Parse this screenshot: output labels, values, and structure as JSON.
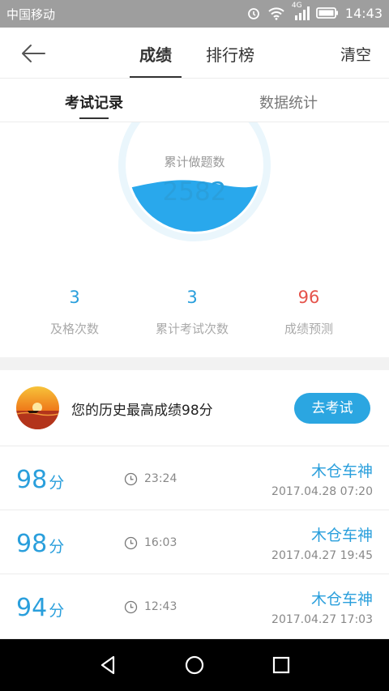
{
  "status_bar": {
    "carrier": "中国移动",
    "time": "14:43",
    "network": "4G"
  },
  "header": {
    "back_icon": "back-arrow-icon",
    "tabs": [
      {
        "label": "成绩",
        "active": true
      },
      {
        "label": "排行榜",
        "active": false
      }
    ],
    "clear_label": "清空"
  },
  "sub_tabs": [
    {
      "label": "考试记录",
      "active": true
    },
    {
      "label": "数据统计",
      "active": false
    }
  ],
  "summary": {
    "gauge_label": "累计做题数",
    "gauge_value": "2582",
    "stats": [
      {
        "value": "3",
        "label": "及格次数",
        "color": "#2a9fdc"
      },
      {
        "value": "3",
        "label": "累计考试次数",
        "color": "#2a9fdc"
      },
      {
        "value": "96",
        "label": "成绩预测",
        "color": "#e5534b"
      }
    ]
  },
  "best": {
    "text": "您的历史最高成绩98分",
    "button_label": "去考试"
  },
  "records": [
    {
      "score": "98",
      "unit": "分",
      "duration": "23:24",
      "name": "木仓车神",
      "date": "2017.04.28  07:20"
    },
    {
      "score": "98",
      "unit": "分",
      "duration": "16:03",
      "name": "木仓车神",
      "date": "2017.04.27  19:45"
    },
    {
      "score": "94",
      "unit": "分",
      "duration": "12:43",
      "name": "木仓车神",
      "date": "2017.04.27  17:03"
    }
  ],
  "colors": {
    "accent": "#2a9fdc",
    "button": "#2ba6e1",
    "prediction": "#e5534b"
  }
}
